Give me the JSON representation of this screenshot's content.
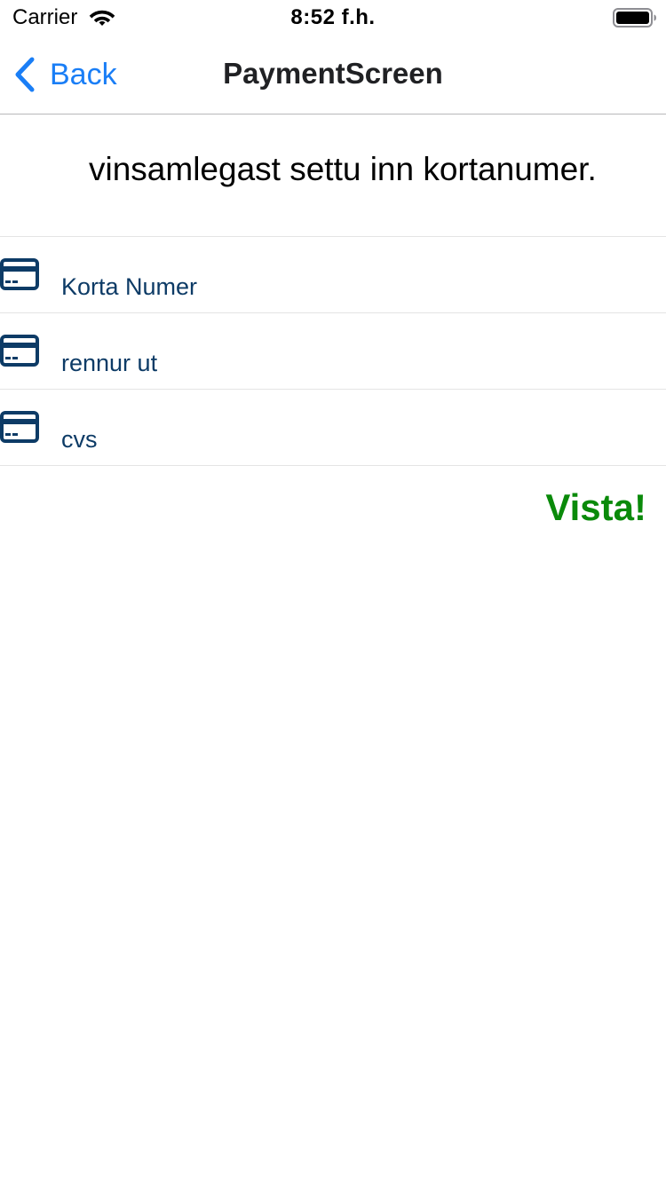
{
  "status_bar": {
    "carrier": "Carrier",
    "time": "8:52 f.h.",
    "wifi_icon": "wifi-icon",
    "battery_icon": "battery-icon"
  },
  "nav": {
    "back_label": "Back",
    "title": "PaymentScreen",
    "accent_color": "#1a7ef6"
  },
  "instruction": "vinsamlegast settu inn kortanumer.",
  "fields": [
    {
      "icon": "credit-card-icon",
      "placeholder": "Korta Numer",
      "value": ""
    },
    {
      "icon": "credit-card-icon",
      "placeholder": "rennur ut",
      "value": ""
    },
    {
      "icon": "credit-card-icon",
      "placeholder": "cvs",
      "value": ""
    }
  ],
  "field_color": "#0d3b66",
  "submit": {
    "label": "Vista!",
    "color": "#0a8a0a"
  }
}
